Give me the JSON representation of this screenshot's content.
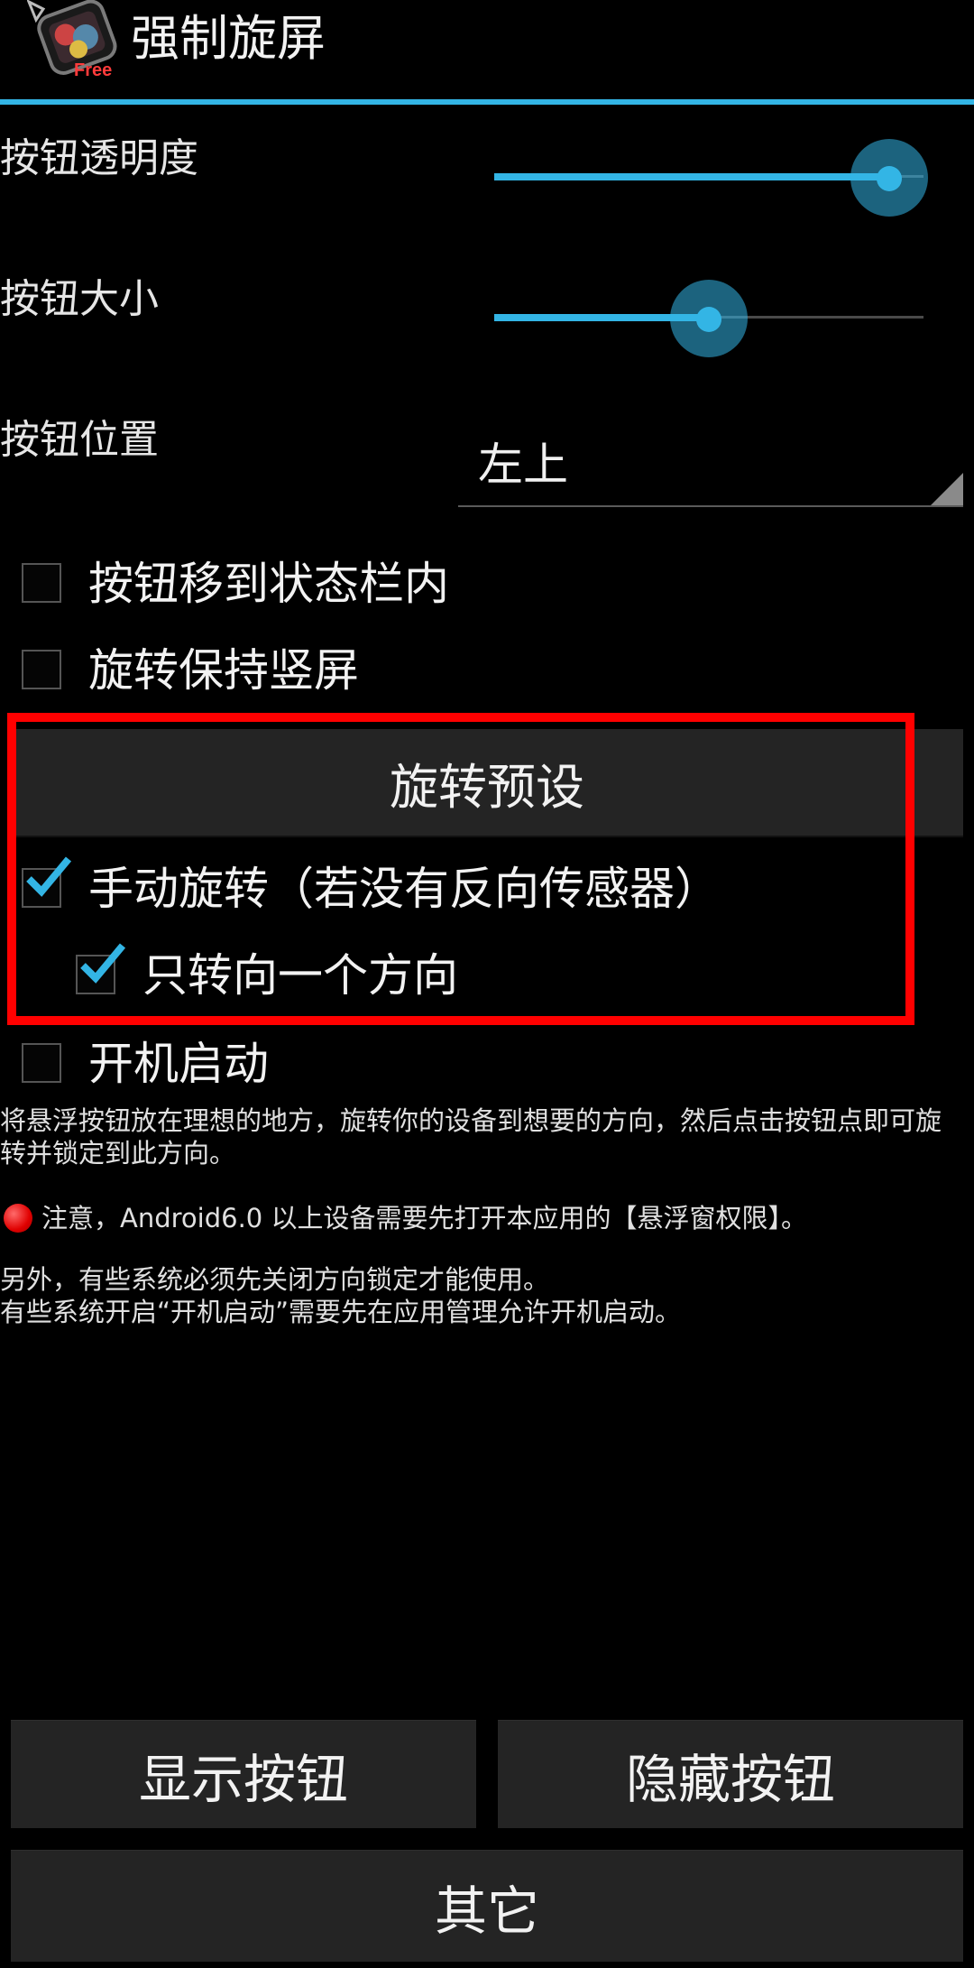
{
  "app": {
    "title": "强制旋屏",
    "badge": "Free"
  },
  "settings": {
    "opacity_label": "按钮透明度",
    "opacity_value": 0.92,
    "size_label": "按钮大小",
    "size_value": 0.5,
    "position_label": "按钮位置",
    "position_value": "左上"
  },
  "checkboxes": [
    {
      "label": "按钮移到状态栏内",
      "checked": false
    },
    {
      "label": "旋转保持竖屏",
      "checked": false
    },
    {
      "label": "手动旋转（若没有反向传感器）",
      "checked": true
    },
    {
      "label": "只转向一个方向",
      "checked": true
    },
    {
      "label": "开机启动",
      "checked": false
    }
  ],
  "preset_button": "旋转预设",
  "info": {
    "line1": "将悬浮按钮放在理想的地方，旋转你的设备到想要的方向，然后点击按钮点即可旋",
    "line2": "转并锁定到此方向。",
    "notice": "注意，Android6.0 以上设备需要先打开本应用的【悬浮窗权限】。",
    "extra1": "另外，有些系统必须先关闭方向锁定才能使用。",
    "extra2": "有些系统开启“开机启动”需要先在应用管理允许开机启动。"
  },
  "buttons": {
    "show": "显示按钮",
    "hide": "隐藏按钮",
    "other": "其它"
  },
  "colors": {
    "accent": "#33b5e5",
    "highlight": "#ff0000"
  }
}
